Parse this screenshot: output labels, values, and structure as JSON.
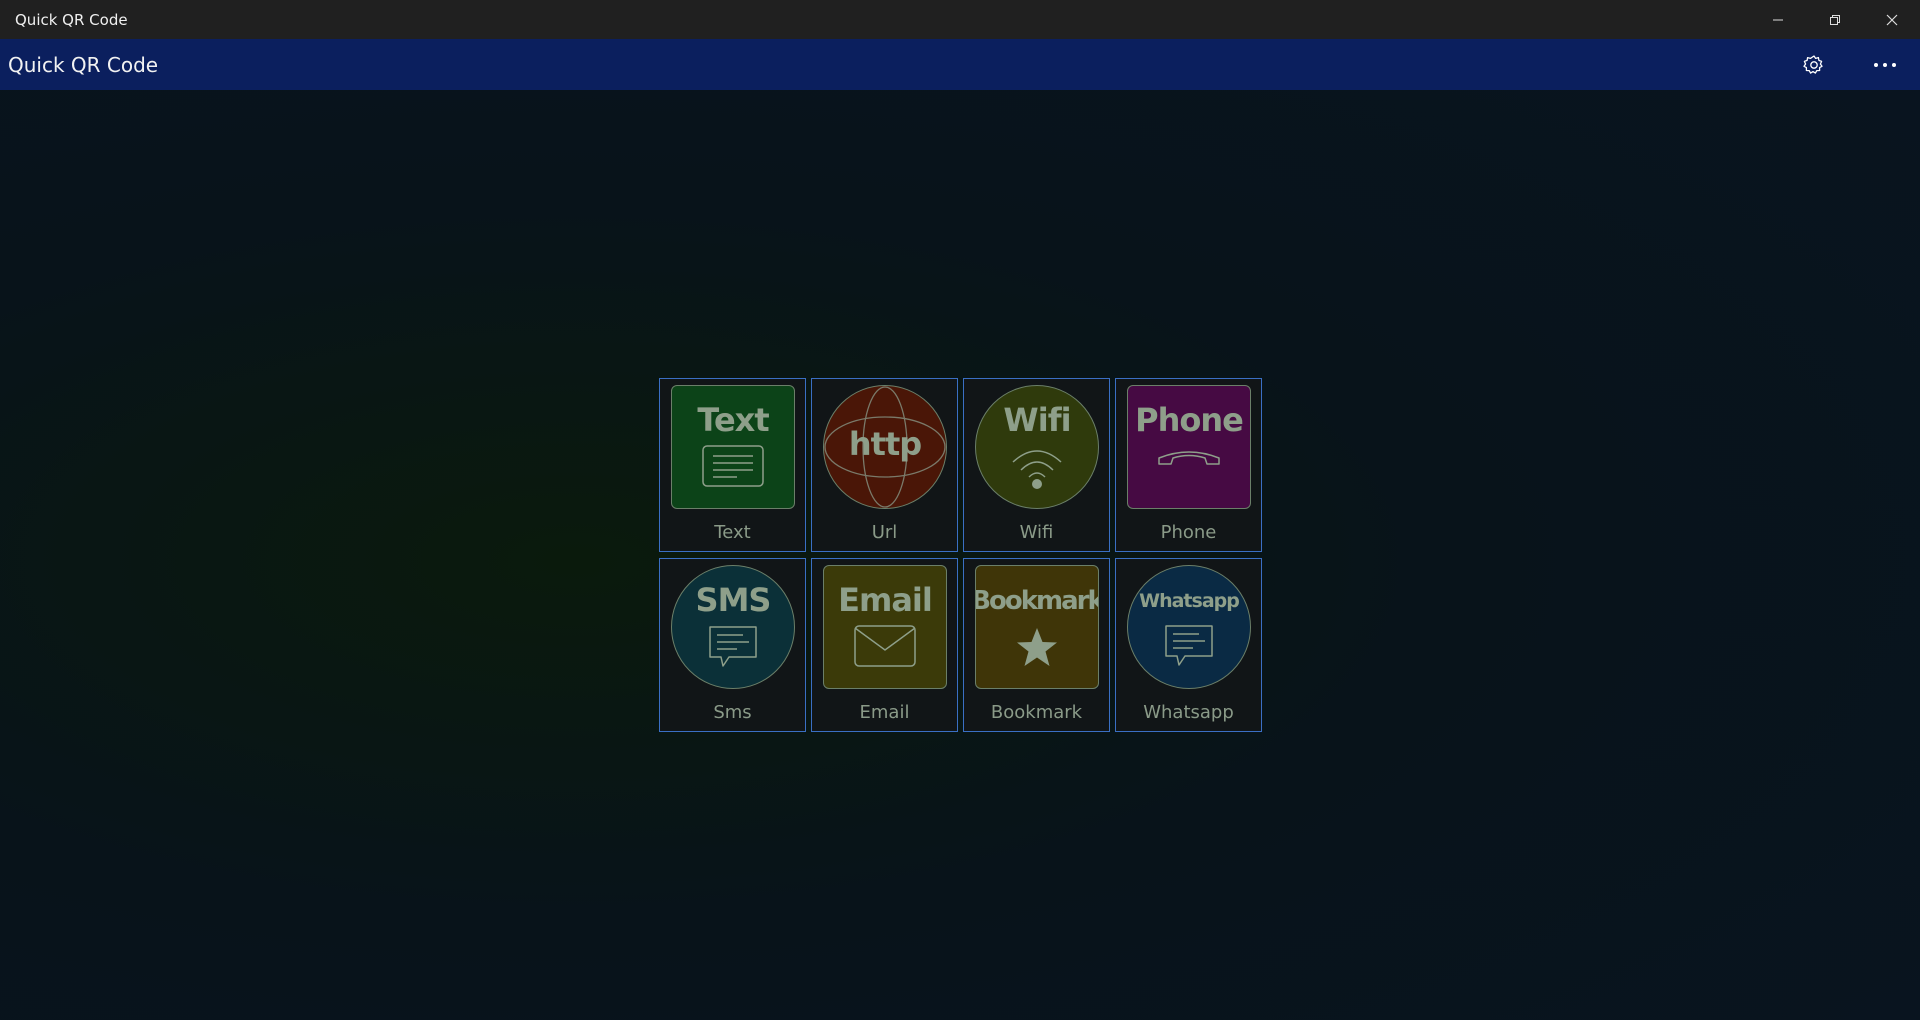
{
  "window": {
    "title": "Quick QR Code"
  },
  "appbar": {
    "title": "Quick QR Code"
  },
  "tiles": [
    {
      "label": "Text",
      "word": "Text",
      "shape": "square",
      "color": "#0c4318",
      "icon": "document-lines-icon"
    },
    {
      "label": "Url",
      "word": "http",
      "shape": "circle",
      "color": "#4a1607",
      "icon": "globe-icon"
    },
    {
      "label": "Wifi",
      "word": "Wifi",
      "shape": "circle",
      "color": "#2f3a0c",
      "icon": "wifi-icon"
    },
    {
      "label": "Phone",
      "word": "Phone",
      "shape": "square",
      "color": "#460a43",
      "icon": "phone-icon"
    },
    {
      "label": "Sms",
      "word": "SMS",
      "shape": "circle",
      "color": "#0b3038",
      "icon": "chat-bubble-icon"
    },
    {
      "label": "Email",
      "word": "Email",
      "shape": "square",
      "color": "#3b3a09",
      "icon": "envelope-icon"
    },
    {
      "label": "Bookmark",
      "word": "Bookmark",
      "shape": "square",
      "color": "#3f3508",
      "icon": "star-icon"
    },
    {
      "label": "Whatsapp",
      "word": "Whatsapp",
      "shape": "circle",
      "color": "#0a2a44",
      "icon": "chat-bubble-icon"
    }
  ]
}
